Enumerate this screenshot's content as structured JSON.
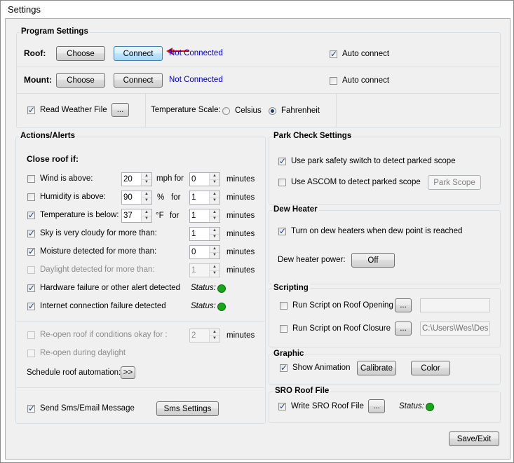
{
  "window": {
    "title": "Settings"
  },
  "program_settings": {
    "title": "Program Settings",
    "roof": {
      "label": "Roof:",
      "choose": "Choose",
      "connect": "Connect",
      "status": "Not Connected",
      "auto_connect": "Auto connect",
      "auto_connect_checked": true
    },
    "mount": {
      "label": "Mount:",
      "choose": "Choose",
      "connect": "Connect",
      "status": "Not Connected",
      "auto_connect": "Auto connect",
      "auto_connect_checked": false
    },
    "weather": {
      "label": "Read Weather File",
      "checked": true,
      "browse": "..."
    },
    "temperature": {
      "label": "Temperature Scale:",
      "celsius": "Celsius",
      "fahrenheit": "Fahrenheit",
      "selected": "Fahrenheit"
    }
  },
  "actions": {
    "title": "Actions/Alerts",
    "close_roof_if": "Close roof if:",
    "wind": {
      "label": "Wind is above:",
      "checked": false,
      "value": "20",
      "unit": "mph for",
      "minutes_value": "0",
      "minutes": "minutes"
    },
    "humidity": {
      "label": "Humidity is above:",
      "checked": false,
      "value": "90",
      "unit": "%",
      "for": "for",
      "minutes_value": "1",
      "minutes": "minutes"
    },
    "temperature": {
      "label": "Temperature is below:",
      "checked": true,
      "value": "37",
      "unit": "°F",
      "for": "for",
      "minutes_value": "1",
      "minutes": "minutes"
    },
    "cloudy": {
      "label": "Sky is very cloudy for more than:",
      "checked": true,
      "minutes_value": "1",
      "minutes": "minutes"
    },
    "moisture": {
      "label": "Moisture detected for more than:",
      "checked": true,
      "minutes_value": "0",
      "minutes": "minutes"
    },
    "daylight": {
      "label": "Daylight detected for more than:",
      "checked": false,
      "minutes_value": "1",
      "minutes": "minutes"
    },
    "hardware": {
      "label": "Hardware failure or other alert detected",
      "checked": true,
      "status": "Status:"
    },
    "internet": {
      "label": "Internet connection failure detected",
      "checked": true,
      "status": "Status:"
    },
    "reopen": {
      "label": "Re-open roof if conditions okay for :",
      "value": "2",
      "minutes": "minutes"
    },
    "reopen_daylight": {
      "label": "Re-open during daylight"
    },
    "schedule": {
      "label": "Schedule roof automation:",
      "button": ">>"
    },
    "sms": {
      "label": "Send Sms/Email Message",
      "checked": true,
      "button": "Sms Settings"
    }
  },
  "park_check": {
    "title": "Park Check Settings",
    "safety_switch": {
      "label": "Use park safety switch to detect parked scope",
      "checked": true
    },
    "ascom": {
      "label": "Use ASCOM to detect parked scope",
      "checked": false
    },
    "park_scope": "Park Scope"
  },
  "dew": {
    "title": "Dew Heater",
    "auto": {
      "label": "Turn on dew heaters when dew point is reached",
      "checked": true
    },
    "power_label": "Dew heater power:",
    "power_button": "Off"
  },
  "scripting": {
    "title": "Scripting",
    "opening": {
      "label": "Run Script on Roof Opening",
      "browse": "...",
      "path": ""
    },
    "closure": {
      "label": "Run Script on Roof Closure",
      "browse": "...",
      "path": "C:\\Users\\Wes\\Des"
    }
  },
  "graphic": {
    "title": "Graphic",
    "animation": {
      "label": "Show Animation",
      "checked": true
    },
    "calibrate": "Calibrate",
    "color": "Color"
  },
  "sro": {
    "title": "SRO Roof File",
    "write": {
      "label": "Write SRO Roof File",
      "checked": true,
      "browse": "...",
      "status": "Status:"
    }
  },
  "save_exit": "Save/Exit",
  "colors": {
    "status_ok": "#1aa61a",
    "link": "#0000d0",
    "arrow": "#e00000"
  }
}
